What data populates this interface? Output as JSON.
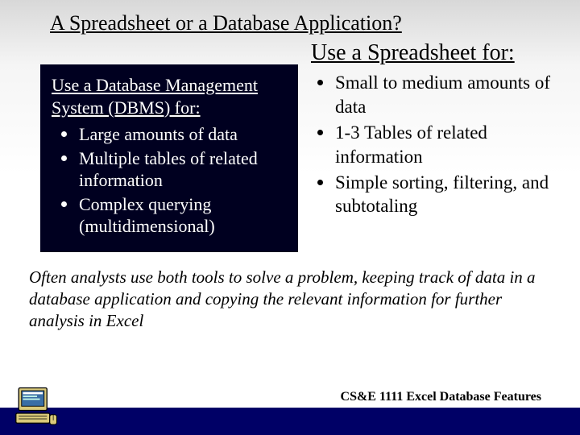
{
  "title": "A Spreadsheet or a Database Application?",
  "dbms": {
    "heading": "Use a Database Management System (DBMS) for:",
    "items": [
      "Large amounts of data",
      "Multiple tables of related information",
      "Complex querying (multidimensional)"
    ]
  },
  "spreadsheet": {
    "heading": "Use a Spreadsheet for:",
    "items": [
      "Small to medium amounts of data",
      " 1-3  Tables of related information",
      "Simple sorting, filtering, and subtotaling"
    ]
  },
  "note": "Often analysts use both tools to solve a problem, keeping track of data in a database application and copying the relevant information for further analysis in Excel",
  "footer": "CS&E 1111 Excel Database Features"
}
